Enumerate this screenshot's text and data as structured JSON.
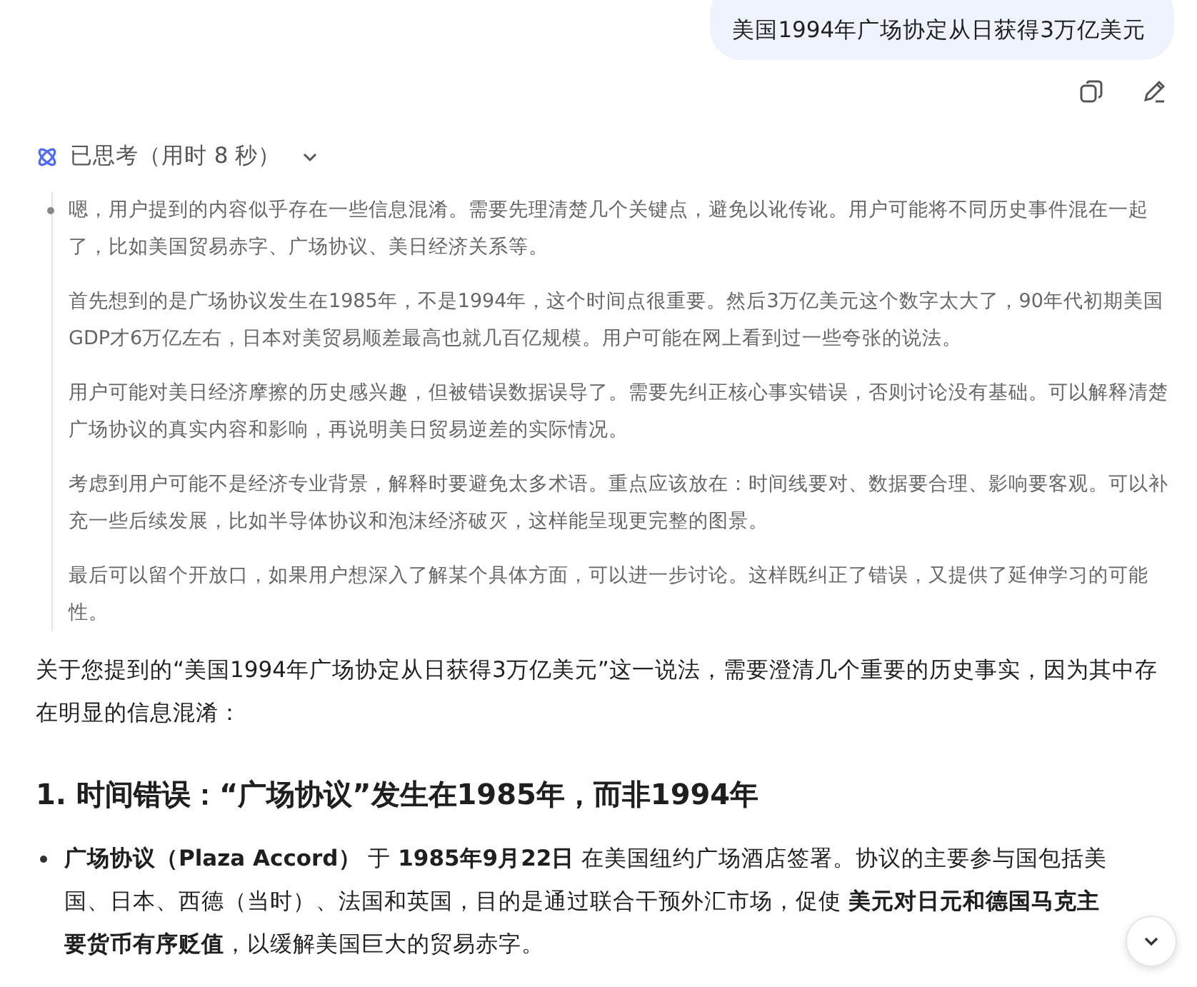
{
  "user_message": {
    "text": "美国1994年广场协定从日获得3万亿美元"
  },
  "message_actions": [
    {
      "kind": "copy"
    },
    {
      "kind": "edit"
    }
  ],
  "thinking": {
    "label": "已思考（用时 8 秒）",
    "expanded": true,
    "paragraphs": [
      "嗯，用户提到的内容似乎存在一些信息混淆。需要先理清楚几个关键点，避免以讹传讹。用户可能将不同历史事件混在一起了，比如美国贸易赤字、广场协议、美日经济关系等。",
      "首先想到的是广场协议发生在1985年，不是1994年，这个时间点很重要。然后3万亿美元这个数字太大了，90年代初期美国GDP才6万亿左右，日本对美贸易顺差最高也就几百亿规模。用户可能在网上看到过一些夸张的说法。",
      "用户可能对美日经济摩擦的历史感兴趣，但被错误数据误导了。需要先纠正核心事实错误，否则讨论没有基础。可以解释清楚广场协议的真实内容和影响，再说明美日贸易逆差的实际情况。",
      "考虑到用户可能不是经济专业背景，解释时要避免太多术语。重点应该放在：时间线要对、数据要合理、影响要客观。可以补充一些后续发展，比如半导体协议和泡沫经济破灭，这样能呈现更完整的图景。",
      "最后可以留个开放口，如果用户想深入了解某个具体方面，可以进一步讨论。这样既纠正了错误，又提供了延伸学习的可能性。"
    ]
  },
  "answer": {
    "intro": "关于您提到的“美国1994年广场协定从日获得3万亿美元”这一说法，需要澄清几个重要的历史事实，因为其中存在明显的信息混淆：",
    "heading": "1. 时间错误：“广场协议”发生在1985年，而非1994年",
    "bullets": [
      "**广场协议（Plaza Accord）** 于 **1985年9月22日** 在美国纽约广场酒店签署。协议的主要参与国包括美国、日本、西德（当时）、法国和英国，目的是通过联合干预外汇市场，促使 **美元对日元和德国马克主要货币有序贬值**，以缓解美国巨大的贸易赤字。"
    ]
  },
  "scroll_down_button": {
    "kind": "chevron-down"
  }
}
